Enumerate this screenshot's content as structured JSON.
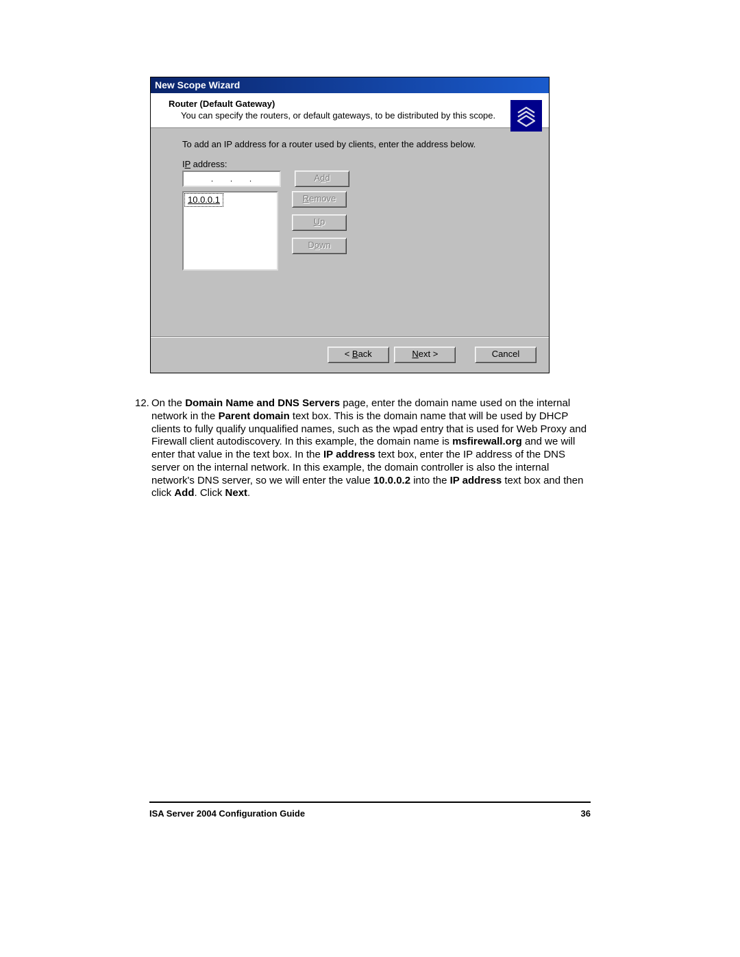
{
  "wizard": {
    "title": "New Scope Wizard",
    "header_title": "Router (Default Gateway)",
    "header_subtitle": "You can specify the routers, or default gateways, to be distributed by this scope.",
    "body_instruction": "To add an IP address for a router used by clients, enter the address below.",
    "ip_label_prefix": "I",
    "ip_label_ul": "P",
    "ip_label_suffix": " address:",
    "ip_input_value": "   .   .   .   ",
    "listbox_item": "10.0.0.1",
    "buttons": {
      "add": "Add",
      "remove": "Remove",
      "up": "Up",
      "down": "Down",
      "back": "< Back",
      "next": "Next >",
      "cancel": "Cancel"
    }
  },
  "step": {
    "number": "12.",
    "t1": "On the ",
    "b1": "Domain Name and DNS Servers",
    "t2": " page, enter the domain name used on the internal network in the ",
    "b2": "Parent domain",
    "t3": " text box. This is the domain name that will be used by DHCP clients to fully qualify unqualified names, such as the wpad entry that is used for Web Proxy and Firewall client autodiscovery. In this example, the domain name is ",
    "b3": "msfirewall.org",
    "t4": " and we will enter that value in the text box. In the ",
    "b4": "IP address",
    "t5": " text box, enter the IP address of the DNS server on the internal network. In this example, the domain controller is also the internal network's DNS server, so we will enter the value ",
    "b5": "10.0.0.2",
    "t6": " into the ",
    "b6": "IP address",
    "t7": " text box and then click ",
    "b7": "Add",
    "t8": ". Click ",
    "b8": "Next",
    "t9": "."
  },
  "footer": {
    "title": "ISA Server 2004 Configuration Guide",
    "page": "36"
  }
}
